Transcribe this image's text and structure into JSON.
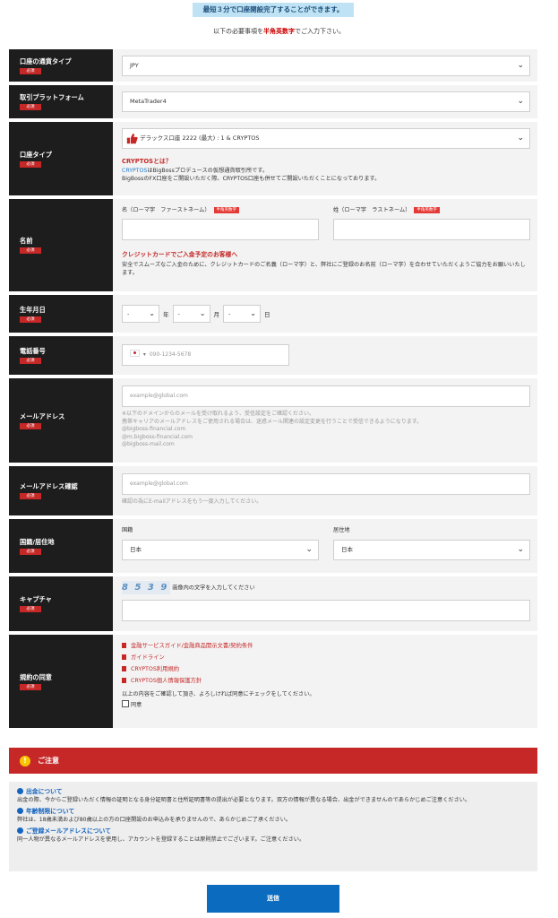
{
  "banner": "最短３分で口座開設完了することができます。",
  "subtitle": {
    "before": "以下の必要事項を",
    "highlight": "半角英数字",
    "after": "でご入力下さい。"
  },
  "required_label": "必須",
  "currency": {
    "label": "口座の通貨タイプ",
    "value": "JPY"
  },
  "platform": {
    "label": "取引プラットフォーム",
    "value": "MetaTrader4"
  },
  "account_type": {
    "label": "口座タイプ",
    "value": "デラックス口座 2222 (最大) : 1 & CRYPTOS",
    "crypto_title": "CRYPTOSとは？",
    "crypto_link": "CRYPTOS",
    "crypto_desc1": "はBigBossプロデュースの仮想通貨取引所です。",
    "crypto_desc2": "BigBossのFX口座をご開設いただく際、CRYPTOS口座も併せてご開設いただくことになっております。"
  },
  "name": {
    "label": "名前",
    "first_label": "名（ローマ字　ファーストネーム）",
    "last_label": "姓（ローマ字　ラストネーム）",
    "badge": "半角英数字",
    "card_title": "クレジットカードでご入金予定のお客様へ",
    "card_desc": "安全でスムーズなご入金のために、クレジットカードのご名義（ローマ字）と、弊社にご登録のお名前（ローマ字）を合わせていただくようご協力をお願いいたします。"
  },
  "birthday": {
    "label": "生年月日",
    "year_value": "-",
    "month_value": "-",
    "day_value": "-",
    "year": "年",
    "month": "月",
    "day": "日"
  },
  "phone": {
    "label": "電話番号",
    "placeholder": "090-1234-5678"
  },
  "email": {
    "label": "メールアドレス",
    "placeholder": "example@global.com",
    "note1": "※以下のドメインからのメールを受け取れるよう、受信設定をご確認ください。",
    "note2": "携帯キャリアのメールアドレスをご使用される場合は、迷惑メール関連の設定変更を行うことで受信できるようになります。",
    "domain1": "@bigboss-financial.com",
    "domain2": "@m.bigboss-financial.com",
    "domain3": "@bigboss-mail.com"
  },
  "email_confirm": {
    "label": "メールアドレス確認",
    "placeholder": "example@global.com",
    "note": "確認の為にE-mailアドレスをもう一度入力してください。"
  },
  "country": {
    "label": "国籍/居住地",
    "nationality_label": "国籍",
    "nationality_value": "日本",
    "residence_label": "居住地",
    "residence_value": "日本"
  },
  "captcha": {
    "label": "キャプチャ",
    "image_text": "8 5 3 9",
    "instruction": "画像内の文字を入力してください"
  },
  "terms": {
    "label": "規約の同意",
    "links": [
      "金融サービスガイド/金融商品開示文書/契約条件",
      "ガイドライン",
      "CRYPTOS利用規約",
      "CRYPTOS個人情報保護方針"
    ],
    "confirm_text": "以上の内容をご確認して頂き、よろしければ同意にチェックをしてください。",
    "agree": "同意"
  },
  "notice": {
    "title": "ご注意",
    "items": [
      {
        "heading": "出金について",
        "text": "出金の際、今からご登録いただく情報の証明となる身分証明書と住所証明書等の提出が必要となります。双方の情報が異なる場合、出金ができませんのであらかじめご注意ください。"
      },
      {
        "heading": "年齢制限について",
        "text": "弊社は、18歳未満および80歳以上の方の口座開設のお申込みを承りませんので、あらかじめご了承ください。"
      },
      {
        "heading": "ご登録メールアドレスについて",
        "text": "同一人物が異なるメールアドレスを使用し、アカウントを登録することは原則禁止でございます。ご注意ください。"
      }
    ]
  },
  "submit": "送信",
  "colors": {
    "accent_red": "#c62828",
    "label_bg": "#1d1d1d",
    "submit_blue": "#0b6cbf",
    "link_blue": "#1e7bd0"
  }
}
